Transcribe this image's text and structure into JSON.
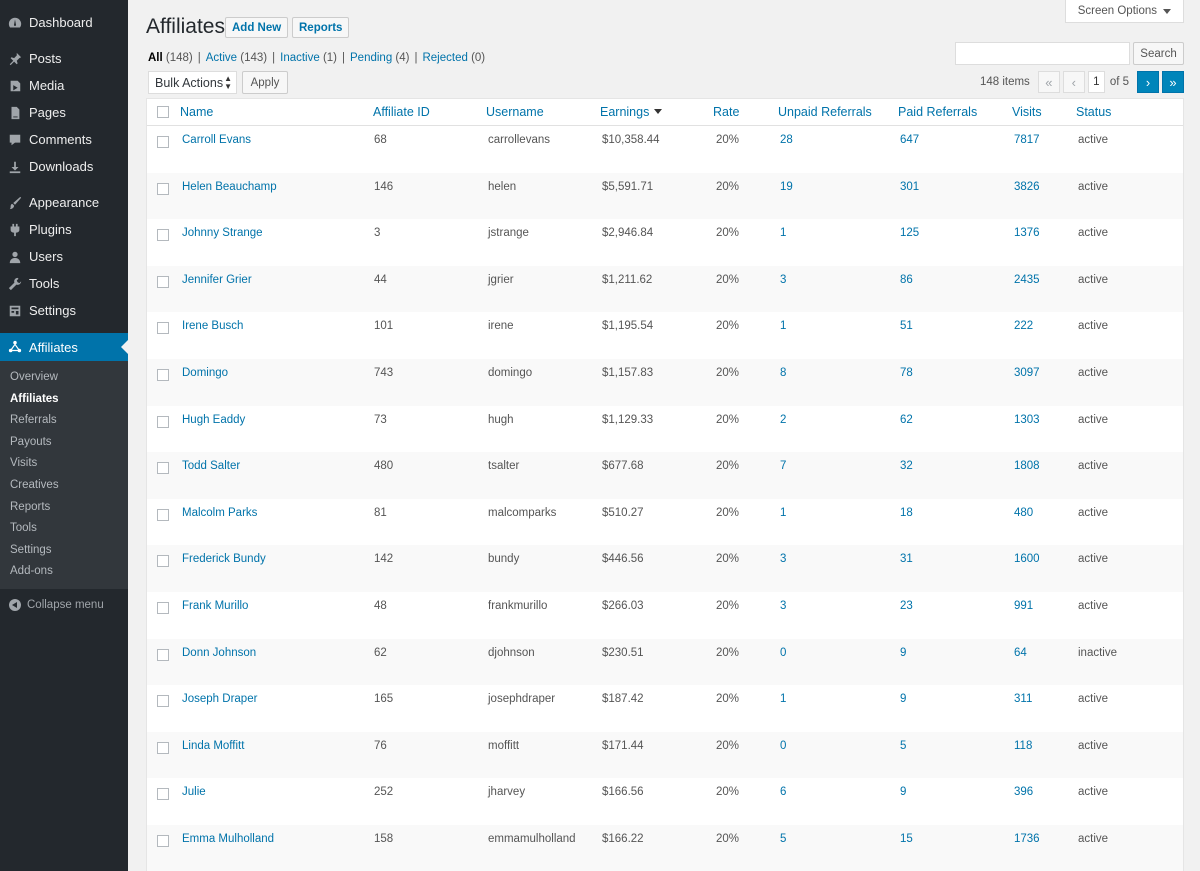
{
  "sidebar": {
    "items_top": [
      {
        "label": "Dashboard",
        "icon": "dashboard-icon"
      }
    ],
    "items_main": [
      {
        "label": "Posts",
        "icon": "pin-icon"
      },
      {
        "label": "Media",
        "icon": "media-icon"
      },
      {
        "label": "Pages",
        "icon": "page-icon"
      },
      {
        "label": "Comments",
        "icon": "comment-icon"
      },
      {
        "label": "Downloads",
        "icon": "download-icon"
      }
    ],
    "items_admin": [
      {
        "label": "Appearance",
        "icon": "brush-icon"
      },
      {
        "label": "Plugins",
        "icon": "plugin-icon"
      },
      {
        "label": "Users",
        "icon": "user-icon"
      },
      {
        "label": "Tools",
        "icon": "wrench-icon"
      },
      {
        "label": "Settings",
        "icon": "settings-icon"
      }
    ],
    "current": {
      "label": "Affiliates",
      "icon": "affiliates-icon"
    },
    "submenu": [
      "Overview",
      "Affiliates",
      "Referrals",
      "Payouts",
      "Visits",
      "Creatives",
      "Reports",
      "Tools",
      "Settings",
      "Add-ons"
    ],
    "submenu_active": "Affiliates",
    "collapse_label": "Collapse menu"
  },
  "header": {
    "screen_options": "Screen Options",
    "title": "Affiliates",
    "add_new": "Add New",
    "reports": "Reports"
  },
  "filters": [
    {
      "label": "All",
      "count": "(148)",
      "current": true
    },
    {
      "label": "Active",
      "count": "(143)",
      "current": false
    },
    {
      "label": "Inactive",
      "count": "(1)",
      "current": false
    },
    {
      "label": "Pending",
      "count": "(4)",
      "current": false
    },
    {
      "label": "Rejected",
      "count": "(0)",
      "current": false
    }
  ],
  "search": {
    "value": "",
    "button": "Search"
  },
  "bulk": {
    "selected": "Bulk Actions",
    "apply": "Apply"
  },
  "pagination": {
    "items": "148 items",
    "first": "«",
    "prev": "‹",
    "current_page": "1",
    "of_total": "of 5",
    "next": "›",
    "last": "»"
  },
  "table": {
    "columns": [
      "Name",
      "Affiliate ID",
      "Username",
      "Earnings",
      "Rate",
      "Unpaid Referrals",
      "Paid Referrals",
      "Visits",
      "Status"
    ],
    "sorted_column": "Earnings",
    "rows": [
      [
        "Carroll Evans",
        "68",
        "carrollevans",
        "$10,358.44",
        "20%",
        "28",
        "647",
        "7817",
        "active"
      ],
      [
        "Helen Beauchamp",
        "146",
        "helen",
        "$5,591.71",
        "20%",
        "19",
        "301",
        "3826",
        "active"
      ],
      [
        "Johnny Strange",
        "3",
        "jstrange",
        "$2,946.84",
        "20%",
        "1",
        "125",
        "1376",
        "active"
      ],
      [
        "Jennifer Grier",
        "44",
        "jgrier",
        "$1,211.62",
        "20%",
        "3",
        "86",
        "2435",
        "active"
      ],
      [
        "Irene Busch",
        "101",
        "irene",
        "$1,195.54",
        "20%",
        "1",
        "51",
        "222",
        "active"
      ],
      [
        "Domingo",
        "743",
        "domingo",
        "$1,157.83",
        "20%",
        "8",
        "78",
        "3097",
        "active"
      ],
      [
        "Hugh Eaddy",
        "73",
        "hugh",
        "$1,129.33",
        "20%",
        "2",
        "62",
        "1303",
        "active"
      ],
      [
        "Todd Salter",
        "480",
        "tsalter",
        "$677.68",
        "20%",
        "7",
        "32",
        "1808",
        "active"
      ],
      [
        "Malcolm Parks",
        "81",
        "malcomparks",
        "$510.27",
        "20%",
        "1",
        "18",
        "480",
        "active"
      ],
      [
        "Frederick Bundy",
        "142",
        "bundy",
        "$446.56",
        "20%",
        "3",
        "31",
        "1600",
        "active"
      ],
      [
        "Frank Murillo",
        "48",
        "frankmurillo",
        "$266.03",
        "20%",
        "3",
        "23",
        "991",
        "active"
      ],
      [
        "Donn Johnson",
        "62",
        "djohnson",
        "$230.51",
        "20%",
        "0",
        "9",
        "64",
        "inactive"
      ],
      [
        "Joseph Draper",
        "165",
        "josephdraper",
        "$187.42",
        "20%",
        "1",
        "9",
        "311",
        "active"
      ],
      [
        "Linda Moffitt",
        "76",
        "moffitt",
        "$171.44",
        "20%",
        "0",
        "5",
        "118",
        "active"
      ],
      [
        "Julie",
        "252",
        "jharvey",
        "$166.56",
        "20%",
        "6",
        "9",
        "396",
        "active"
      ],
      [
        "Emma Mulholland",
        "158",
        "emmamulholland",
        "$166.22",
        "20%",
        "5",
        "15",
        "1736",
        "active"
      ]
    ]
  },
  "colors": {
    "sidebar_bg": "#23282d",
    "submenu_bg": "#32373c",
    "accent": "#0073aa",
    "page_bg": "#f1f1f1"
  }
}
